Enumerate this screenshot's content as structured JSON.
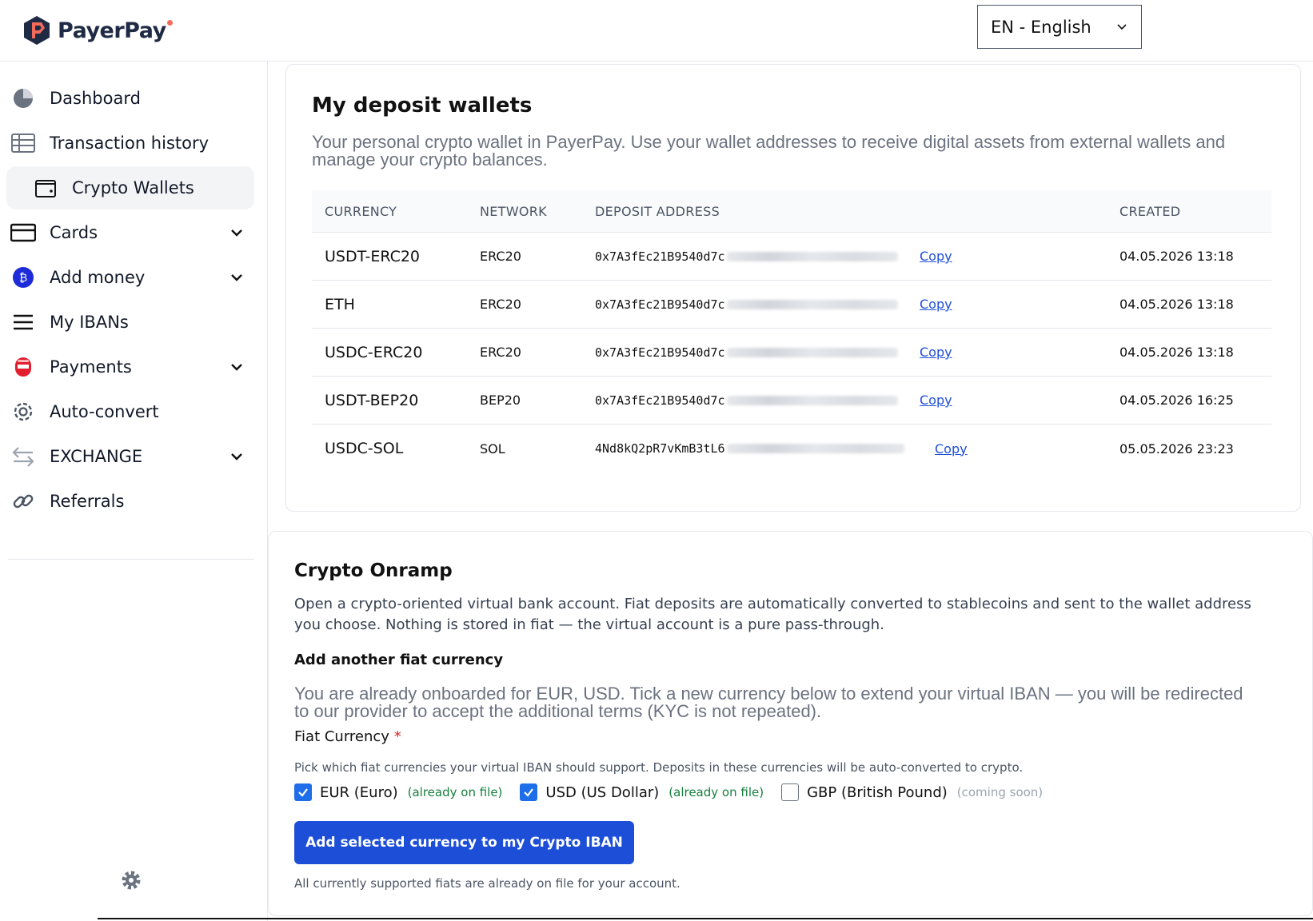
{
  "header": {
    "brand": "PayerPay",
    "language": "EN - English",
    "colors": {
      "brand_navy": "#1f2a44",
      "brand_orange": "#f26b5b",
      "accent": "#1d4ed8"
    }
  },
  "sidebar": {
    "items": [
      {
        "label": "Dashboard",
        "icon": "pie-chart-icon"
      },
      {
        "label": "Transaction history",
        "icon": "table-icon"
      },
      {
        "label": "Crypto Wallets",
        "icon": "wallet-icon",
        "active": true
      },
      {
        "label": "Cards",
        "icon": "card-icon",
        "expandable": true
      },
      {
        "label": "Add money",
        "icon": "add-money-icon",
        "expandable": true
      },
      {
        "label": "My IBANs",
        "icon": "menu-lines-icon"
      },
      {
        "label": "Payments",
        "icon": "payments-icon",
        "expandable": true
      },
      {
        "label": "Auto-convert",
        "icon": "gear-icon"
      },
      {
        "label": "EXCHANGE",
        "icon": "exchange-arrows-icon",
        "expandable": true
      },
      {
        "label": "Referrals",
        "icon": "link-icon"
      }
    ],
    "footer_icon": "settings-gear-icon"
  },
  "wallets": {
    "title": "My deposit wallets",
    "description": "Your personal crypto wallet in PayerPay. Use your wallet addresses to receive digital assets from external wallets and manage your crypto balances.",
    "columns": [
      "CURRENCY",
      "NETWORK",
      "DEPOSIT ADDRESS",
      "CREATED"
    ],
    "rows": [
      {
        "currency": "USDT-ERC20",
        "network": "ERC20",
        "address": "0x7A3fEc21B9540d7c",
        "copy": "Copy",
        "created": "04.05.2026 13:18"
      },
      {
        "currency": "ETH",
        "network": "ERC20",
        "address": "0x7A3fEc21B9540d7c",
        "copy": "Copy",
        "created": "04.05.2026 13:18"
      },
      {
        "currency": "USDC-ERC20",
        "network": "ERC20",
        "address": "0x7A3fEc21B9540d7c",
        "copy": "Copy",
        "created": "04.05.2026 13:18"
      },
      {
        "currency": "USDT-BEP20",
        "network": "BEP20",
        "address": "0x7A3fEc21B9540d7c",
        "copy": "Copy",
        "created": "04.05.2026 16:25"
      },
      {
        "currency": "USDC-SOL",
        "network": "SOL",
        "address": "4Nd8kQ2pR7vKmB3tL6",
        "copy": "Copy",
        "created": "05.05.2026 23:23"
      }
    ]
  },
  "onramp": {
    "title": "Crypto Onramp",
    "description": "Open a crypto-oriented virtual bank account. Fiat deposits are automatically converted to stablecoins and sent to the wallet address you choose. Nothing is stored in fiat — the virtual account is a pure pass-through.",
    "subheading": "Add another fiat currency",
    "note": "You are already onboarded for EUR, USD. Tick a new currency below to extend your virtual IBAN — you will be redirected to our provider to accept the additional terms (KYC is not repeated).",
    "fiat_label": "Fiat Currency",
    "required_mark": "*",
    "fiat_help": "Pick which fiat currencies your virtual IBAN should support. Deposits in these currencies will be auto-converted to crypto.",
    "options": [
      {
        "label": "EUR (Euro)",
        "note": "(already on file)",
        "checked": true
      },
      {
        "label": "USD (US Dollar)",
        "note": "(already on file)",
        "checked": true
      },
      {
        "label": "GBP (British Pound)",
        "note": "(coming soon)",
        "checked": false
      }
    ],
    "button": "Add selected currency to my Crypto IBAN",
    "footer": "All currently supported fiats are already on file for your account."
  }
}
